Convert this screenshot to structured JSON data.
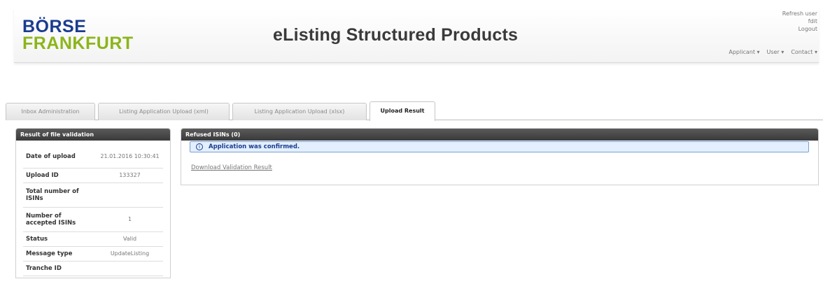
{
  "header": {
    "logo_line1": "BÖRSE",
    "logo_line2": "FRANKFURT",
    "app_title": "eListing Structured Products",
    "user_links": [
      "Refresh user",
      "fdit",
      "Logout"
    ],
    "menu": [
      "Applicant ▾",
      "User ▾",
      "Contact ▾"
    ]
  },
  "tabs": [
    {
      "label": "Inbox Administration",
      "active": false
    },
    {
      "label": "Listing Application Upload (xml)",
      "active": false
    },
    {
      "label": "Listing Application Upload (xlsx)",
      "active": false
    },
    {
      "label": "Upload Result",
      "active": true
    }
  ],
  "validation": {
    "title": "Result of file validation",
    "rows": [
      {
        "label": "Date of upload",
        "value": "21.01.2016 10:30:41"
      },
      {
        "label": "Upload ID",
        "value": "133327"
      },
      {
        "label": "Total number of ISINs",
        "value": ""
      },
      {
        "label": "Number of accepted ISINs",
        "value": "1"
      },
      {
        "label": "Status",
        "value": "Valid"
      },
      {
        "label": "Message type",
        "value": "UpdateListing"
      },
      {
        "label": "Tranche ID",
        "value": ""
      }
    ]
  },
  "refused": {
    "title": "Refused ISINs (0)",
    "alert": "Application was confirmed.",
    "download_link": "Download Validation Result"
  }
}
